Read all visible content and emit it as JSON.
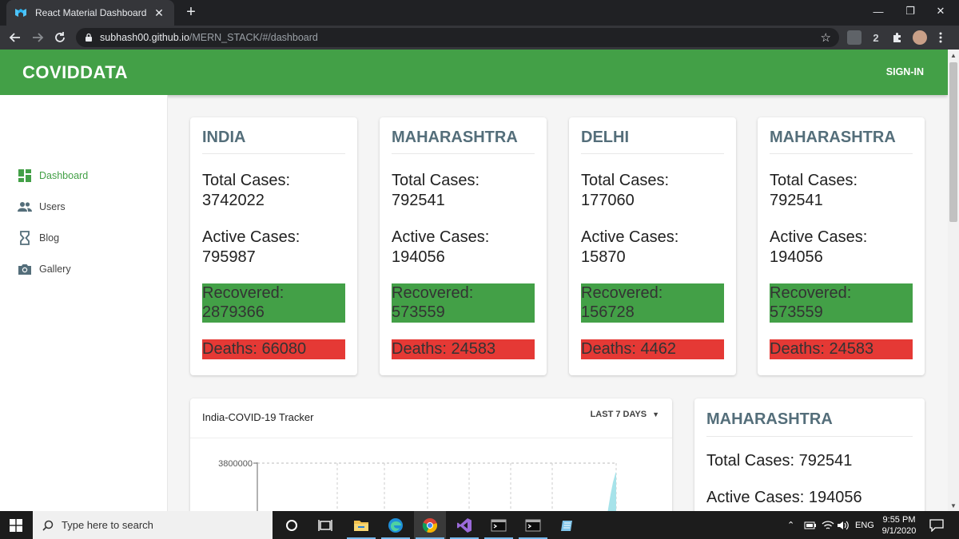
{
  "browser": {
    "tab_title": "React Material Dashboard",
    "tab_close": "✕",
    "new_tab": "+",
    "url_host": "subhash00.github.io",
    "url_path": "/MERN_STACK/#/dashboard",
    "extension_badge": "2",
    "controls": {
      "minimize": "—",
      "maximize": "❐",
      "close": "✕"
    }
  },
  "app": {
    "brand": "COVIDDATA",
    "sign_in": "SIGN-IN",
    "accent_color": "#43a047",
    "recovered_color": "#43a047",
    "deaths_color": "#e53935"
  },
  "sidebar": {
    "items": [
      {
        "label": "Dashboard",
        "icon": "dashboard-icon",
        "active": true
      },
      {
        "label": "Users",
        "icon": "people-icon",
        "active": false
      },
      {
        "label": "Blog",
        "icon": "hourglass-icon",
        "active": false
      },
      {
        "label": "Gallery",
        "icon": "camera-icon",
        "active": false
      }
    ]
  },
  "stat_cards": [
    {
      "title": "INDIA",
      "total_label": "Total Cases:",
      "total": "3742022",
      "active_label": "Active Cases:",
      "active": "795987",
      "recovered_label": "Recovered:",
      "recovered": "2879366",
      "deaths_text": "Deaths: 66080"
    },
    {
      "title": "MAHARASHTRA",
      "total_label": "Total Cases:",
      "total": "792541",
      "active_label": "Active Cases:",
      "active": "194056",
      "recovered_label": "Recovered:",
      "recovered": "573559",
      "deaths_text": "Deaths: 24583"
    },
    {
      "title": "DELHI",
      "total_label": "Total Cases:",
      "total": "177060",
      "active_label": "Active Cases:",
      "active": "15870",
      "recovered_label": "Recovered:",
      "recovered": "156728",
      "deaths_text": "Deaths: 4462"
    },
    {
      "title": "MAHARASHTRA",
      "total_label": "Total Cases:",
      "total": "792541",
      "active_label": "Active Cases:",
      "active": "194056",
      "recovered_label": "Recovered:",
      "recovered": "573559",
      "deaths_text": "Deaths: 24583"
    }
  ],
  "tracker": {
    "title": "India-COVID-19 Tracker",
    "range_label": "LAST 7 DAYS",
    "y_tick_top": "3800000"
  },
  "side_card": {
    "title": "MAHARASHTRA",
    "total_text": "Total Cases: 792541",
    "active_text": "Active Cases: 194056"
  },
  "taskbar": {
    "search_placeholder": "Type here to search",
    "language": "ENG",
    "time": "9:55 PM",
    "date": "9/1/2020"
  }
}
